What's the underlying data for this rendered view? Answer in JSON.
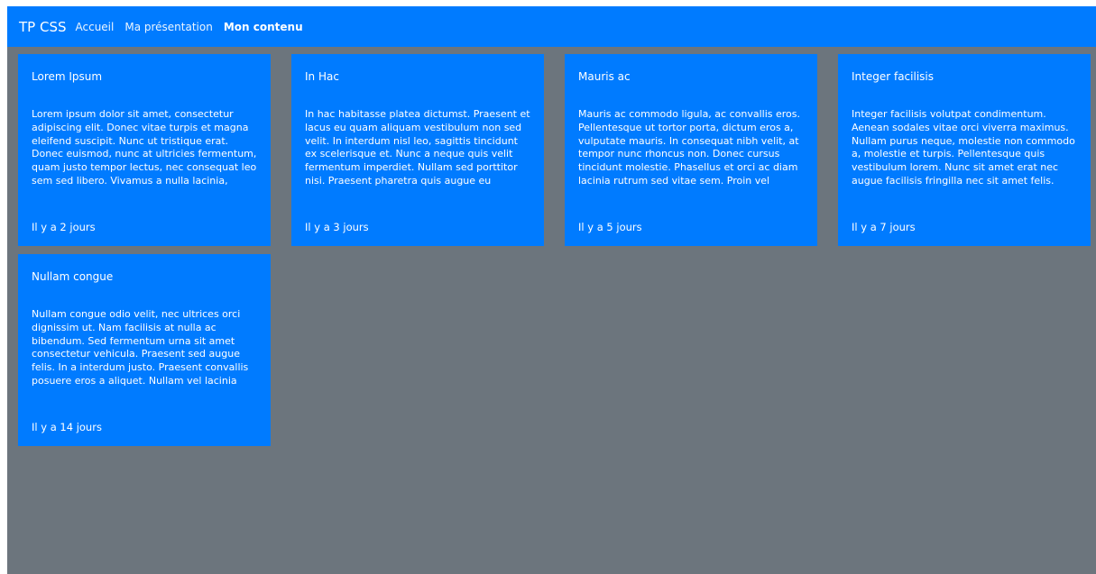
{
  "navbar": {
    "brand": "TP CSS",
    "links": [
      {
        "label": "Accueil",
        "active": false
      },
      {
        "label": "Ma présentation",
        "active": false
      },
      {
        "label": "Mon contenu",
        "active": true
      }
    ]
  },
  "colors": {
    "primary": "#007bff",
    "background": "#6c757d",
    "text": "#ffffff"
  },
  "cards": [
    {
      "title": "Lorem Ipsum",
      "text": "Lorem ipsum dolor sit amet, consectetur adipiscing elit. Donec vitae turpis et magna eleifend suscipit. Nunc ut tristique erat. Donec euismod, nunc at ultricies fermentum, quam justo tempor lectus, nec consequat leo sem sed libero. Vivamus a nulla lacinia, porta lectus",
      "date": "Il y a 2 jours"
    },
    {
      "title": "In Hac",
      "text": "In hac habitasse platea dictumst. Praesent et lacus eu quam aliquam vestibulum non sed velit. In interdum nisl leo, sagittis tincidunt ex scelerisque et. Nunc a neque quis velit fermentum imperdiet. Nullam sed porttitor nisi. Praesent pharetra quis augue eu",
      "date": "Il y a 3 jours"
    },
    {
      "title": "Mauris ac",
      "text": "Mauris ac commodo ligula, ac convallis eros. Pellentesque ut tortor porta, dictum eros a, vulputate mauris. In consequat nibh velit, at tempor nunc rhoncus non. Donec cursus tincidunt molestie. Phasellus et orci ac diam lacinia rutrum sed vitae sem. Proin vel",
      "date": "Il y a 5 jours"
    },
    {
      "title": "Integer facilisis",
      "text": "Integer facilisis volutpat condimentum. Aenean sodales vitae orci viverra maximus. Nullam purus neque, molestie non commodo a, molestie et turpis. Pellentesque quis vestibulum lorem. Nunc sit amet erat nec augue facilisis fringilla nec sit amet felis. Nulla",
      "date": "Il y a 7 jours"
    },
    {
      "title": "Nullam congue",
      "text": "Nullam congue odio velit, nec ultrices orci dignissim ut. Nam facilisis at nulla ac bibendum. Sed fermentum urna sit amet consectetur vehicula. Praesent sed augue felis. In a interdum justo. Praesent convallis posuere eros a aliquet. Nullam vel lacinia augue.",
      "date": "Il y a 14 jours"
    }
  ]
}
